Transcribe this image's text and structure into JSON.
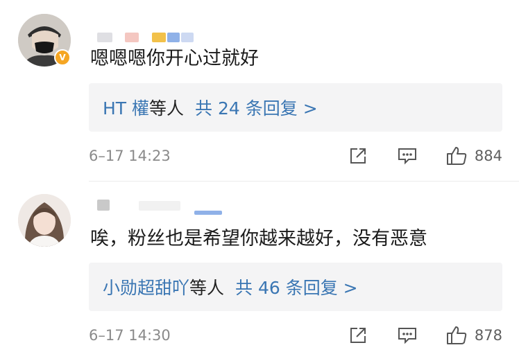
{
  "comments": [
    {
      "text": "嗯嗯嗯你开心过就好",
      "verified": "V",
      "replies": {
        "who": "HT 權",
        "mid": "等人",
        "count": "共 24 条回复 >"
      },
      "time": "6–17 14:23",
      "likes": "884"
    },
    {
      "text": "唉，粉丝也是希望你越来越好，没有恶意",
      "replies": {
        "who": "小勋超甜吖",
        "mid": "等人",
        "count": "共 46 条回复 >"
      },
      "time": "6–17 14:30",
      "likes": "878"
    }
  ],
  "colors": {
    "link": "#3a76b3",
    "badge": "#f5a623",
    "reply_bg": "#f4f4f5",
    "meta": "#8a8a8a"
  },
  "icons": {
    "share": "share-icon",
    "comment": "comment-icon",
    "like": "thumbs-up-icon"
  }
}
